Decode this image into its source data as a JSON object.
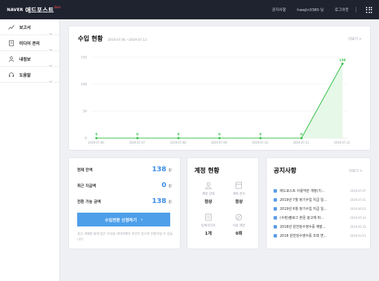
{
  "header": {
    "brand": "NAVER",
    "title": "애드포스트",
    "beta": "Beta",
    "notice_link": "공지사항",
    "user": "hwajin3380 님",
    "logout": "로그아웃"
  },
  "sidebar": {
    "items": [
      {
        "label": "보고서",
        "icon": "chart-line-icon"
      },
      {
        "label": "미디어 관리",
        "icon": "document-icon"
      },
      {
        "label": "내정보",
        "icon": "person-icon"
      },
      {
        "label": "도움말",
        "icon": "headset-icon"
      }
    ]
  },
  "revenue": {
    "title": "수입 현황",
    "date_range": "2019.07.06.~2019.07.12.",
    "more": "더보기 >"
  },
  "chart_data": {
    "type": "area",
    "x": [
      "2019.07.06.",
      "2019.07.07.",
      "2019.07.08.",
      "2019.07.09.",
      "2019.07.10.",
      "2019.07.11.",
      "2019.07.12."
    ],
    "values": [
      0,
      0,
      0,
      0,
      0,
      0,
      138
    ],
    "data_labels": [
      "0",
      "0",
      "0",
      "0",
      "0",
      "0",
      "138"
    ],
    "ylim": [
      0,
      150
    ],
    "yticks": [
      0,
      50,
      100,
      150
    ],
    "grid": true,
    "colors": {
      "line": "#35c24a",
      "fill": "#e6f8e8",
      "marker": "#35c24a"
    }
  },
  "balance": {
    "current_label": "현재 잔액",
    "current_value": "138",
    "recent_label": "최근 지급액",
    "recent_value": "0",
    "convertible_label": "전환 가능 금액",
    "convertible_value": "138",
    "unit": "원",
    "button": "수입전환 신청하기",
    "note": "광고 게재를 통해 얻은 수익을 네이버페이 포인트 등으로 전환하실 수 있습니다."
  },
  "account": {
    "title": "계정 현황",
    "cells": [
      {
        "label": "계정 상태",
        "value": "정상",
        "icon": "user-icon"
      },
      {
        "label": "계좌 번호",
        "value": "정상",
        "icon": "card-icon"
      },
      {
        "label": "등록미디어",
        "value": "1개",
        "icon": "media-icon"
      },
      {
        "label": "이용 제한",
        "value": "0회",
        "icon": "ban-icon"
      }
    ]
  },
  "notices": {
    "title": "공지사항",
    "more": "더보기 >",
    "items": [
      {
        "title": "애드포스트 이용약관 개정(7/...",
        "date": "2019.07.07"
      },
      {
        "title": "2019년 7월 정기수입 지급 일...",
        "date": "2019.07.01"
      },
      {
        "title": "2019년 6월 정기수입 지급 일...",
        "date": "2019.06.03"
      },
      {
        "title": "(수정)블로그 본문 광고에 따...",
        "date": "2019.05.14"
      },
      {
        "title": "2018년 원천징수영수증 재발...",
        "date": "2019.05.10"
      },
      {
        "title": "2018 원천징수영수증 조회 변...",
        "date": "2019.03.03"
      }
    ]
  }
}
